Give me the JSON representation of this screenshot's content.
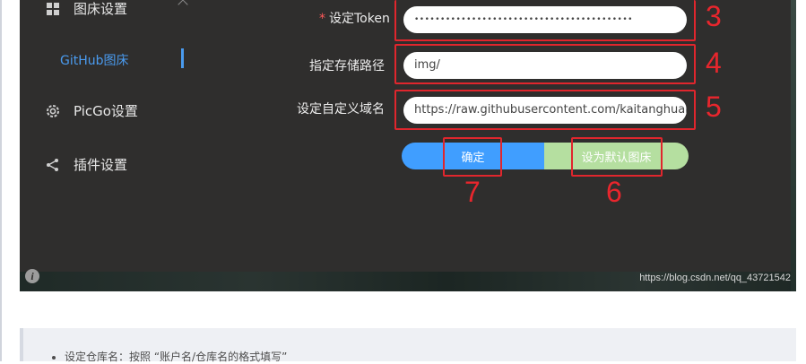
{
  "sidebar": {
    "image_host_settings": "图床设置",
    "github_host": "GitHub图床",
    "picgo_settings": "PicGo设置",
    "plugin_settings": "插件设置"
  },
  "form": {
    "token_required_mark": "*",
    "token_label": "设定Token",
    "token_value": "••••••••••••••••••••••••••••••••••••••••••",
    "path_label": "指定存储路径",
    "path_value": "img/",
    "domain_label": "设定自定义域名",
    "domain_value": "https://raw.githubusercontent.com/kaitanghuang/F",
    "confirm_button": "确定",
    "default_button": "设为默认图床"
  },
  "annotations": {
    "a3": "3",
    "a4": "4",
    "a5": "5",
    "a6": "6",
    "a7": "7"
  },
  "colors": {
    "accent_blue": "#409eff",
    "annotation_red": "#e0262d",
    "success_green": "#b5dfa0"
  },
  "watermark": "https://blog.csdn.net/qq_43721542",
  "info_icon": "i",
  "quote": {
    "item": "设定仓库名：按照 “账户名/仓库名的格式填写”"
  }
}
